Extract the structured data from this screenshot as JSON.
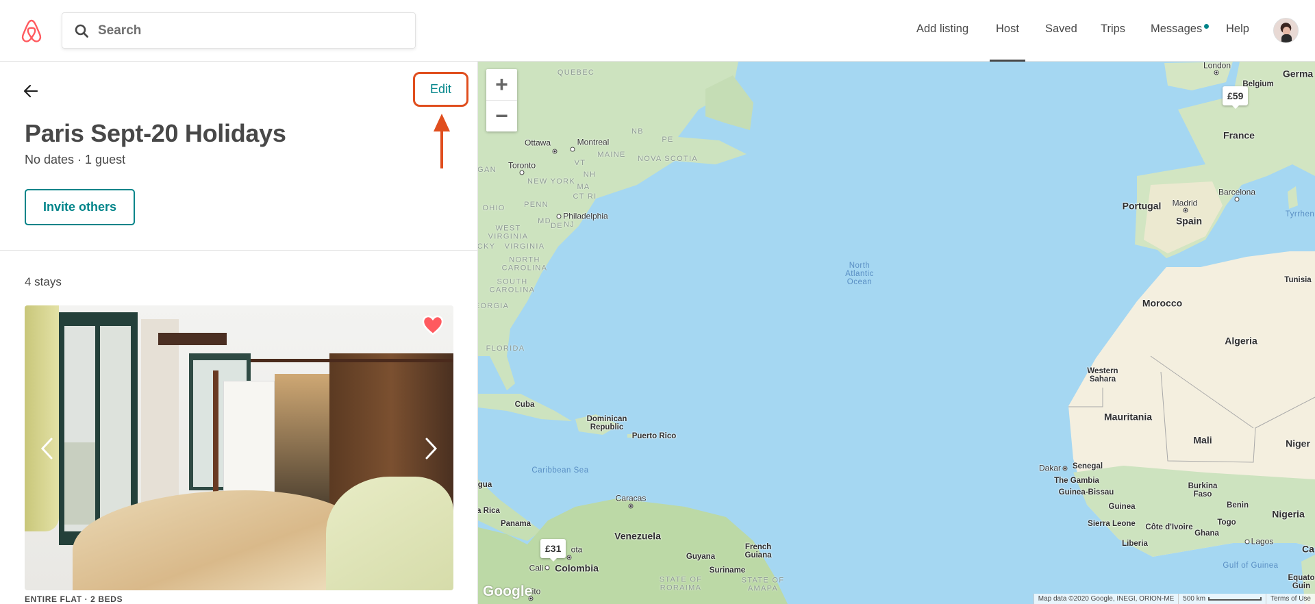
{
  "header": {
    "logo": "airbnb-logo",
    "search_placeholder": "Search",
    "nav": [
      "Add listing",
      "Host",
      "Saved",
      "Trips",
      "Messages",
      "Help"
    ],
    "active_nav": "Host",
    "messages_unread": true,
    "colors": {
      "brand": "#FF5A5F",
      "accent": "#008489"
    }
  },
  "wishlist": {
    "back_icon": "arrow-left-icon",
    "edit_label": "Edit",
    "title": "Paris Sept-20 Holidays",
    "subtitle": "No dates · 1 guest",
    "invite_label": "Invite others",
    "stays_count": "4 stays",
    "listing": {
      "type": "ENTIRE FLAT · 2 BEDS",
      "saved": true
    }
  },
  "annotation": {
    "color": "#E04E1E"
  },
  "map": {
    "zoom_in": "+",
    "zoom_out": "−",
    "markers": [
      "£59",
      "£31"
    ],
    "states": [
      "QUEBEC",
      "NB",
      "PE",
      "MAINE",
      "NOVA SCOTIA",
      "VT",
      "NH",
      "NEW YORK",
      "MA",
      "CT RI",
      "GAN",
      "OHIO",
      "PENN",
      "MD",
      "DE",
      "NJ",
      "WEST\nVIRGINIA",
      "CKY",
      "VIRGINIA",
      "NORTH\nCAROLINA",
      "SOUTH\nCAROLINA",
      "EORGIA",
      "FLORIDA",
      "STATE OF\nRORAIMA",
      "STATE OF\nAMAPA"
    ],
    "cities": [
      "Ottawa",
      "Montreal",
      "Toronto",
      "Philadelphia",
      "Caracas",
      "Cali",
      "ota",
      "ito",
      "London",
      "Barcelona",
      "Madrid",
      "Dakar",
      "Lagos"
    ],
    "countries": [
      "Cuba",
      "Dominican\nRepublic",
      "Puerto Rico",
      "gua",
      "a Rica",
      "Panama",
      "Venezuela",
      "Colombia",
      "Guyana",
      "French\nGuiana",
      "Suriname",
      "Germa",
      "Belgium",
      "France",
      "Portugal",
      "Spain",
      "Morocco",
      "Tunisia",
      "Algeria",
      "Western\nSahara",
      "Mauritania",
      "Mali",
      "Niger",
      "Senegal",
      "The Gambia",
      "Guinea-Bissau",
      "Guinea",
      "Burkina\nFaso",
      "Benin",
      "Nigeria",
      "Sierra Leone",
      "Côte d'Ivoire",
      "Togo",
      "Ghana",
      "Liberia",
      "Ca",
      "Equato\nGuin"
    ],
    "water": [
      "North\nAtlantic\nOcean",
      "Caribbean Sea",
      "Tyrrhen",
      "Gulf of Guinea"
    ],
    "logo": "Google",
    "attribution": "Map data ©2020 Google, INEGI, ORION-ME",
    "scale": "500 km",
    "terms": "Terms of Use",
    "colors": {
      "water": "#A5D7F2",
      "land_green": "#CDE3BF",
      "land_desert": "#F4EFDF"
    }
  }
}
